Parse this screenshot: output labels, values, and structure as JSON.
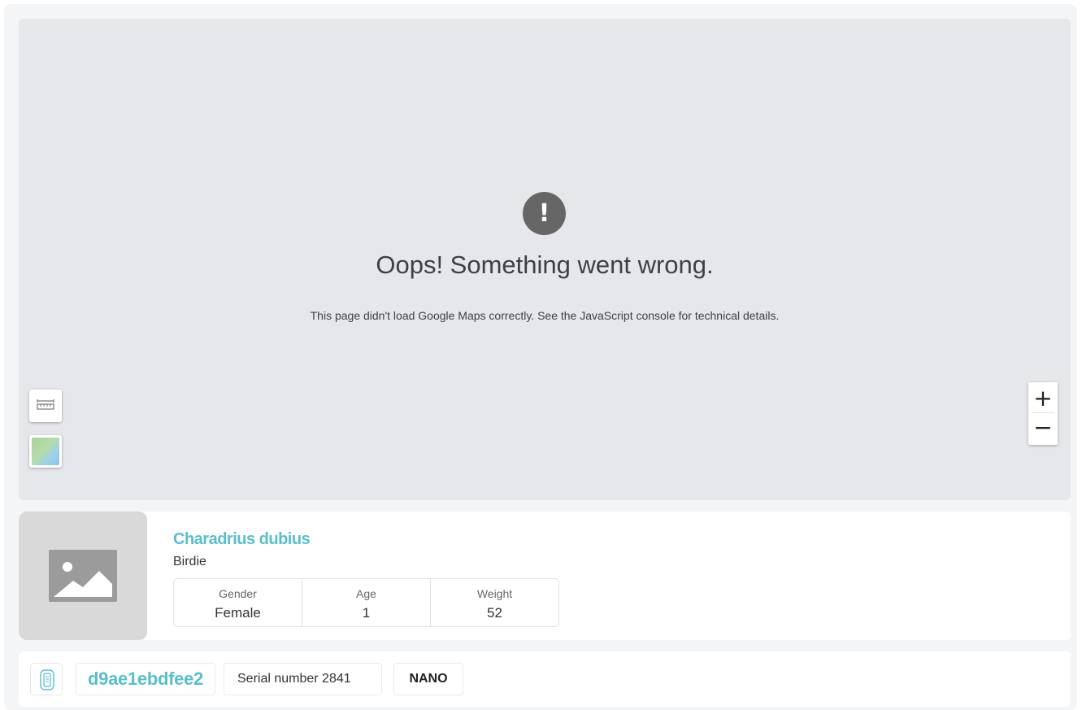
{
  "map": {
    "error_icon_glyph": "!",
    "error_title": "Oops! Something went wrong.",
    "error_description": "This page didn't load Google Maps correctly. See the JavaScript console for technical details.",
    "controls": {
      "ruler_icon": "ruler-icon",
      "layer_icon": "map-layer-icon",
      "zoom_in": "+",
      "zoom_out": "−"
    }
  },
  "animal": {
    "species": "Charadrius dubius",
    "name": "Birdie",
    "photo_icon": "image-placeholder-icon",
    "stats": [
      {
        "label": "Gender",
        "value": "Female"
      },
      {
        "label": "Age",
        "value": "1"
      },
      {
        "label": "Weight",
        "value": "52"
      }
    ]
  },
  "device": {
    "icon": "tracker-device-icon",
    "id": "d9ae1ebdfee2",
    "serial": "Serial number 2841",
    "model": "NANO"
  },
  "colors": {
    "accent": "#5bbecb",
    "map_background": "#e6e7ea",
    "error_icon": "#666666"
  }
}
